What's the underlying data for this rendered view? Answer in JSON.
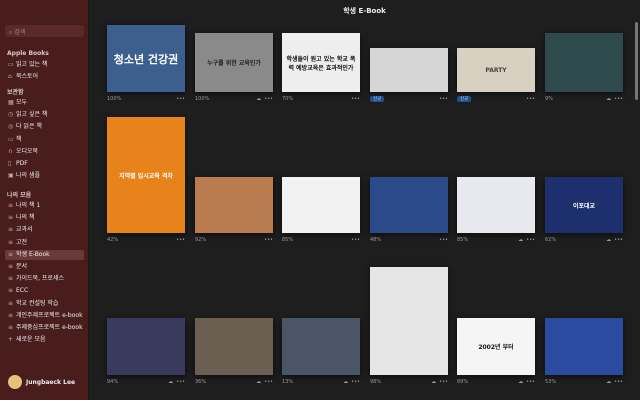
{
  "sidebar": {
    "search_placeholder": "검색",
    "sections": [
      {
        "title": "Apple Books",
        "items": [
          {
            "icon": "book-open-icon",
            "label": "읽고 있는 책"
          },
          {
            "icon": "bag-icon",
            "label": "북스토어"
          }
        ]
      },
      {
        "title": "보관함",
        "items": [
          {
            "icon": "grid-icon",
            "label": "모두"
          },
          {
            "icon": "clock-icon",
            "label": "읽고 싶은 책"
          },
          {
            "icon": "check-circle-icon",
            "label": "다 읽은 책"
          },
          {
            "icon": "book-icon",
            "label": "책"
          },
          {
            "icon": "headphones-icon",
            "label": "오디오북"
          },
          {
            "icon": "document-icon",
            "label": "PDF"
          },
          {
            "icon": "sample-icon",
            "label": "나의 샘플"
          }
        ]
      },
      {
        "title": "나의 모음",
        "items": [
          {
            "icon": "list-icon",
            "label": "나의 책 1"
          },
          {
            "icon": "list-icon",
            "label": "나의 책"
          },
          {
            "icon": "list-icon",
            "label": "교과서"
          },
          {
            "icon": "list-icon",
            "label": "고전"
          },
          {
            "icon": "list-icon",
            "label": "학생 E-Book",
            "selected": true
          },
          {
            "icon": "list-icon",
            "label": "문서"
          },
          {
            "icon": "list-icon",
            "label": "가이드북, 프로세스"
          },
          {
            "icon": "list-icon",
            "label": "ECC"
          },
          {
            "icon": "list-icon",
            "label": "학교 컨설팅 학습"
          },
          {
            "icon": "list-icon",
            "label": "개인주제프로젝트 e-book"
          },
          {
            "icon": "list-icon",
            "label": "주제중심프로젝트 e-book"
          },
          {
            "icon": "plus-icon",
            "label": "새로운 모음"
          }
        ]
      }
    ],
    "user": "Jungbaeck Lee"
  },
  "main": {
    "title": "학생 E-Book",
    "new_badge": "신규",
    "books": [
      {
        "cover": "청소년 건강권",
        "bg": "#3d5f8f",
        "fg": "#fff",
        "progress": "100%",
        "cloud": false
      },
      {
        "cover": "누구를 위한 교육인가",
        "bg": "#8a8a8a",
        "fg": "#222",
        "progress": "100%",
        "cloud": true
      },
      {
        "cover": "학생들이 원고 있는 학교 폭력 예방교육은 효과적인가",
        "bg": "#eeeeee",
        "fg": "#111",
        "progress": "70%",
        "cloud": false
      },
      {
        "cover": "",
        "bg": "#d6d6d6",
        "fg": "#235",
        "progress": "",
        "badge": true,
        "cloud": false
      },
      {
        "cover": "PARTY",
        "bg": "#d8d1c2",
        "fg": "#444",
        "progress": "",
        "badge": true,
        "cloud": false
      },
      {
        "cover": "",
        "bg": "#2e4a4c",
        "fg": "#fff",
        "progress": "9%",
        "cloud": true
      },
      {
        "cover": "지역별 입시교육 격차",
        "bg": "#e8821a",
        "fg": "#fff",
        "progress": "42%",
        "cloud": false
      },
      {
        "cover": "",
        "bg": "#b97c4e",
        "fg": "#222",
        "progress": "92%",
        "cloud": false
      },
      {
        "cover": "",
        "bg": "#f2f2f2",
        "fg": "#111",
        "progress": "85%",
        "cloud": false
      },
      {
        "cover": "",
        "bg": "#2b4a8a",
        "fg": "#fff",
        "progress": "48%",
        "cloud": false
      },
      {
        "cover": "",
        "bg": "#e7e9ef",
        "fg": "#333",
        "progress": "85%",
        "cloud": true
      },
      {
        "cover": "이포대교",
        "bg": "#1d2f6d",
        "fg": "#fff",
        "progress": "62%",
        "cloud": true
      },
      {
        "cover": "",
        "bg": "#3a3a5e",
        "fg": "#fff",
        "progress": "94%",
        "cloud": true
      },
      {
        "cover": "",
        "bg": "#6b5f52",
        "fg": "#fff",
        "progress": "36%",
        "cloud": true
      },
      {
        "cover": "",
        "bg": "#4b5568",
        "fg": "#fff",
        "progress": "13%",
        "cloud": true
      },
      {
        "cover": "",
        "bg": "#e6e6e6",
        "fg": "#111",
        "progress": "98%",
        "cloud": true
      },
      {
        "cover": "2002년 부터",
        "bg": "#f5f5f5",
        "fg": "#111",
        "progress": "89%",
        "cloud": true
      },
      {
        "cover": "",
        "bg": "#2c4aa0",
        "fg": "#fff",
        "progress": "53%",
        "cloud": true
      }
    ]
  }
}
